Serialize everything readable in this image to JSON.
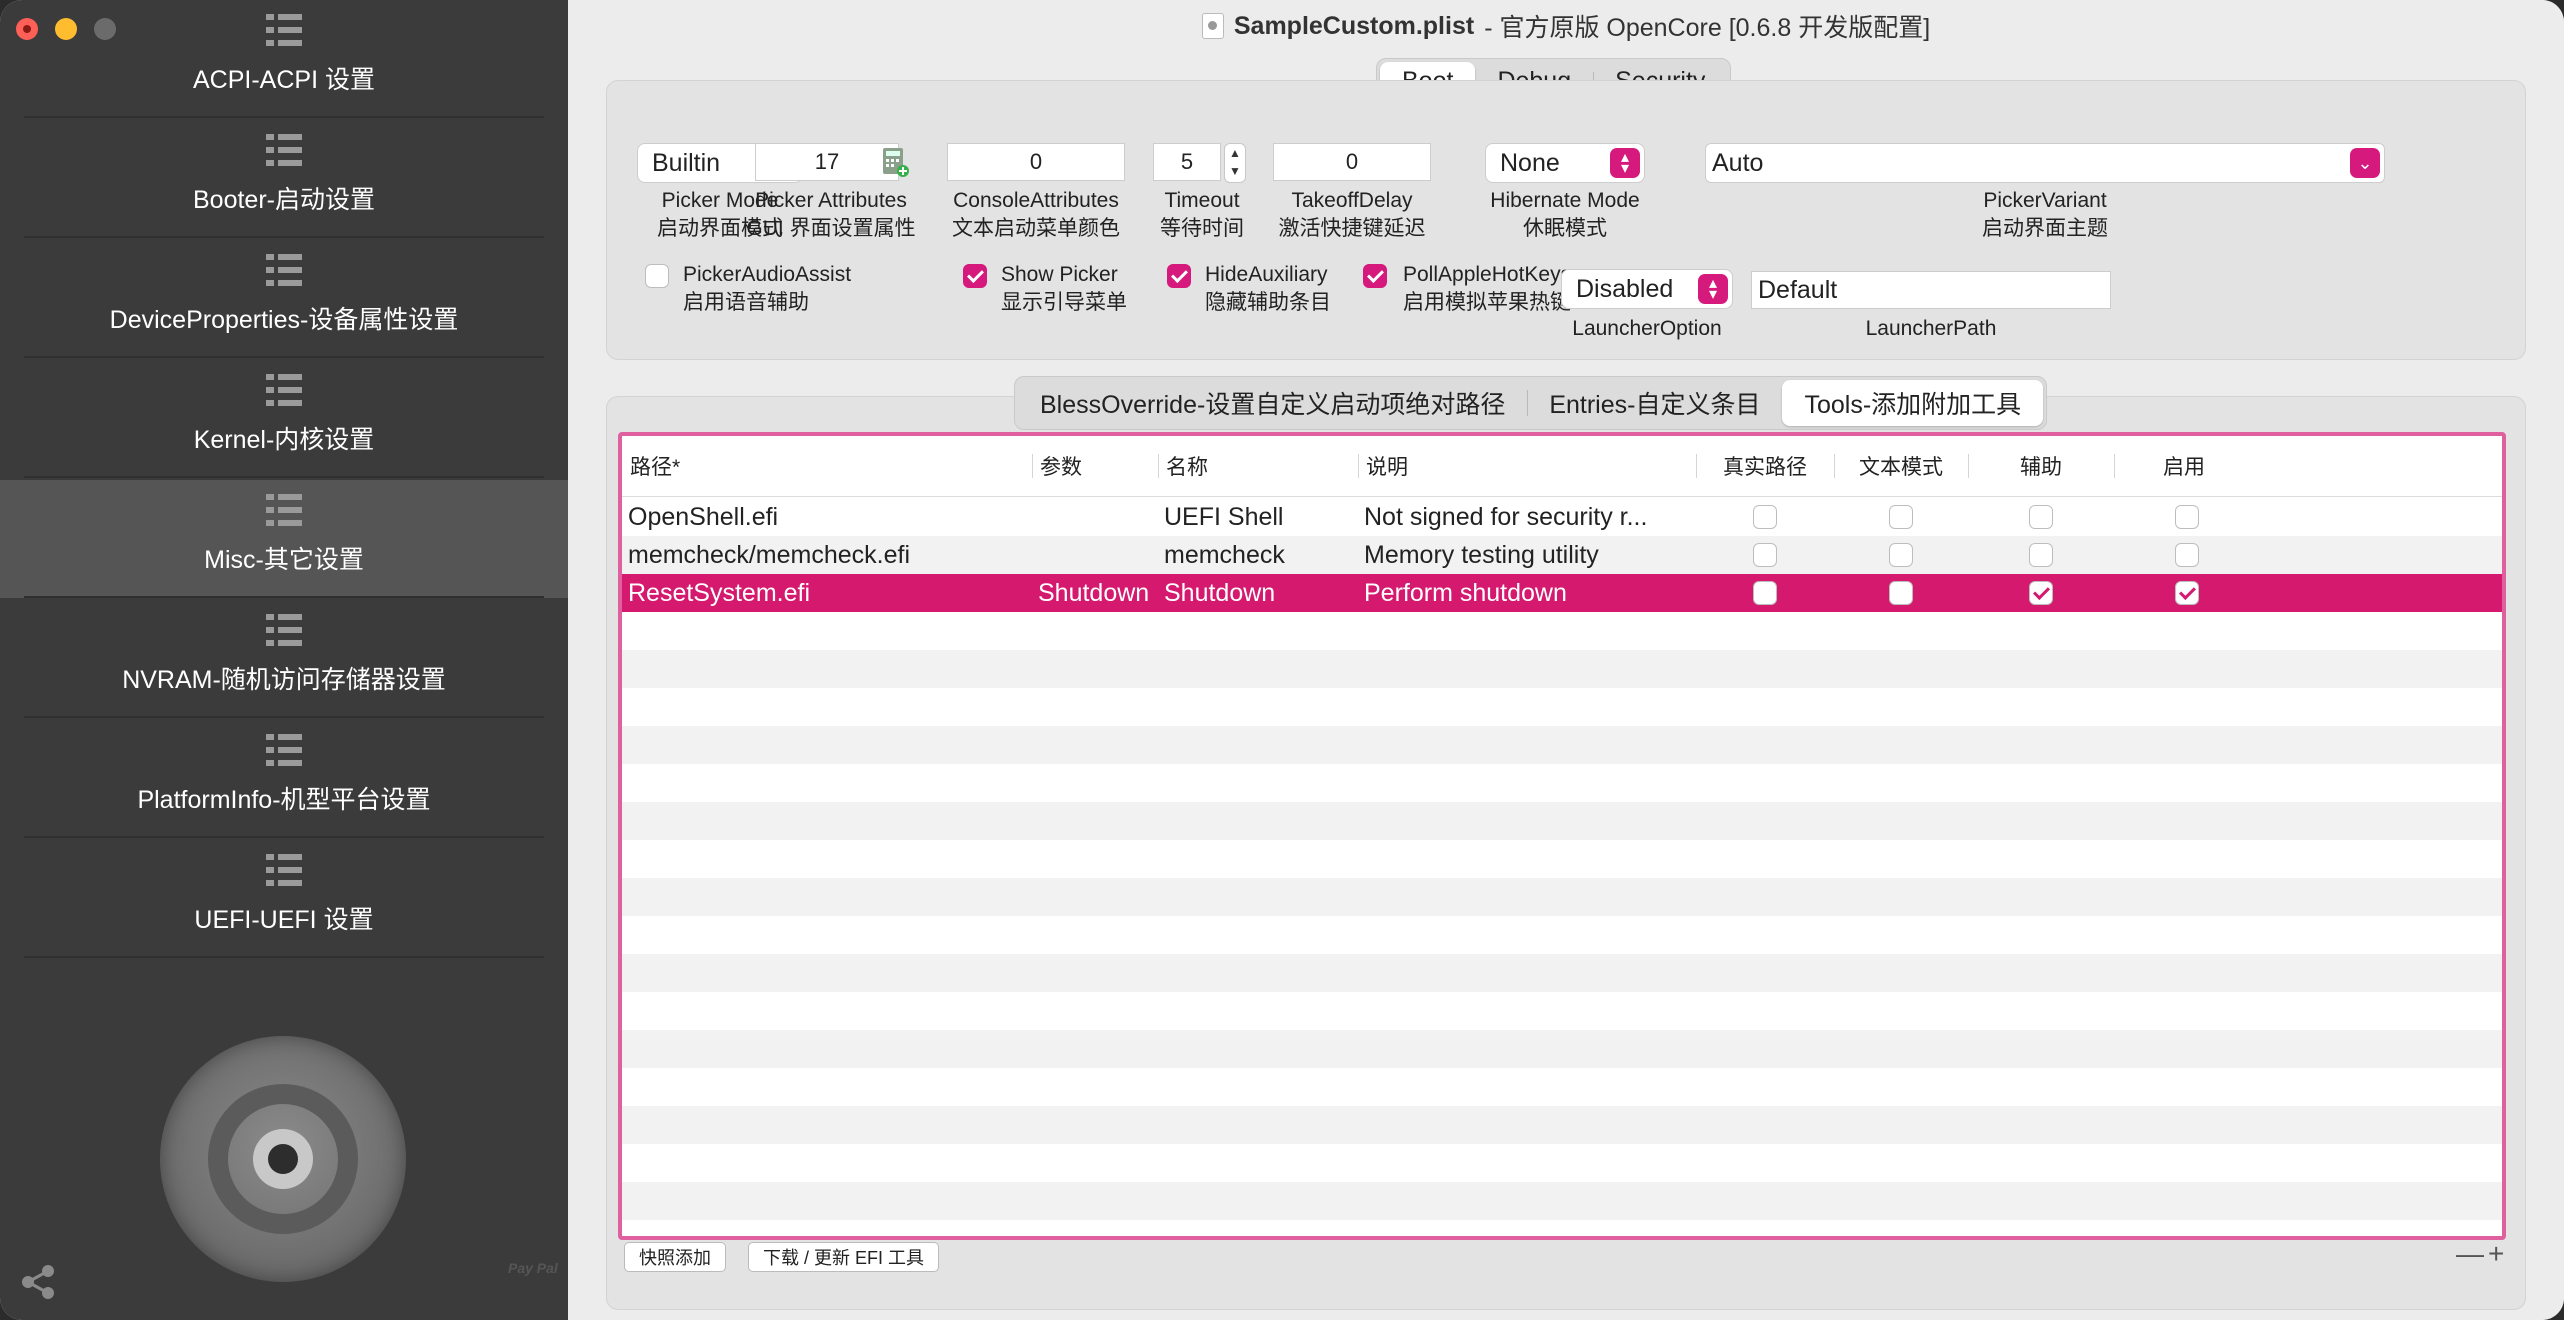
{
  "window": {
    "title_file": "SampleCustom.plist",
    "title_rest": "- 官方原版 OpenCore [0.6.8 开发版配置]"
  },
  "sidebar": {
    "items": [
      {
        "label": "ACPI-ACPI 设置",
        "active": false
      },
      {
        "label": "Booter-启动设置",
        "active": false
      },
      {
        "label": "DeviceProperties-设备属性设置",
        "active": false
      },
      {
        "label": "Kernel-内核设置",
        "active": false
      },
      {
        "label": "Misc-其它设置",
        "active": true
      },
      {
        "label": "NVRAM-随机访问存储器设置",
        "active": false
      },
      {
        "label": "PlatformInfo-机型平台设置",
        "active": false
      },
      {
        "label": "UEFI-UEFI 设置",
        "active": false
      }
    ],
    "paypal_text": "Pay Pal"
  },
  "top_tabs": [
    "Boot",
    "Debug",
    "Security"
  ],
  "boot": {
    "picker_mode": {
      "value": "Builtin",
      "caption1": "Picker Mode",
      "caption2": "启动界面模式"
    },
    "picker_attributes": {
      "value": "17",
      "caption1": "Picker Attributes",
      "caption2": "GUI 界面设置属性"
    },
    "console_attributes": {
      "value": "0",
      "caption1": "ConsoleAttributes",
      "caption2": "文本启动菜单颜色"
    },
    "timeout": {
      "value": "5",
      "caption1": "Timeout",
      "caption2": "等待时间"
    },
    "takeoff_delay": {
      "value": "0",
      "caption1": "TakeoffDelay",
      "caption2": "激活快捷键延迟"
    },
    "hibernate_mode": {
      "value": "None",
      "caption1": "Hibernate Mode",
      "caption2": "休眠模式"
    },
    "picker_variant": {
      "value": "Auto",
      "caption1": "PickerVariant",
      "caption2": "启动界面主题"
    },
    "picker_audio_assist": {
      "label1": "PickerAudioAssist",
      "label2": "启用语音辅助",
      "checked": false
    },
    "show_picker": {
      "label1": "Show Picker",
      "label2": "显示引导菜单",
      "checked": true
    },
    "hide_auxiliary": {
      "label1": "HideAuxiliary",
      "label2": "隐藏辅助条目",
      "checked": true
    },
    "poll_apple_hotkeys": {
      "label1": "PollAppleHotKeys",
      "label2": "启用模拟苹果热键",
      "checked": true
    },
    "launcher_option": {
      "value": "Disabled",
      "caption": "LauncherOption"
    },
    "launcher_path": {
      "value": "Default",
      "caption": "LauncherPath"
    }
  },
  "sub_tabs": [
    "BlessOverride-设置自定义启动项绝对路径",
    "Entries-自定义条目",
    "Tools-添加附加工具"
  ],
  "table": {
    "headers": [
      "路径*",
      "参数",
      "名称",
      "说明",
      "真实路径",
      "文本模式",
      "辅助",
      "启用"
    ],
    "rows": [
      {
        "path": "OpenShell.efi",
        "args": "",
        "name": "UEFI Shell",
        "comment": "Not signed for security r...",
        "realpath": false,
        "textmode": false,
        "auxiliary": false,
        "enabled": false
      },
      {
        "path": "memcheck/memcheck.efi",
        "args": "",
        "name": "memcheck",
        "comment": "Memory testing utility",
        "realpath": false,
        "textmode": false,
        "auxiliary": false,
        "enabled": false
      },
      {
        "path": "ResetSystem.efi",
        "args": "Shutdown",
        "name": "Shutdown",
        "comment": "Perform shutdown",
        "realpath": false,
        "textmode": false,
        "auxiliary": true,
        "enabled": true
      }
    ]
  },
  "bottom": {
    "snapshot_button": "快照添加",
    "download_button": "下载 / 更新 EFI 工具",
    "minus": "—",
    "plus": "+"
  },
  "colors": {
    "accent": "#d6197d",
    "selected_row": "#d4196f",
    "table_border": "#e0609f"
  }
}
